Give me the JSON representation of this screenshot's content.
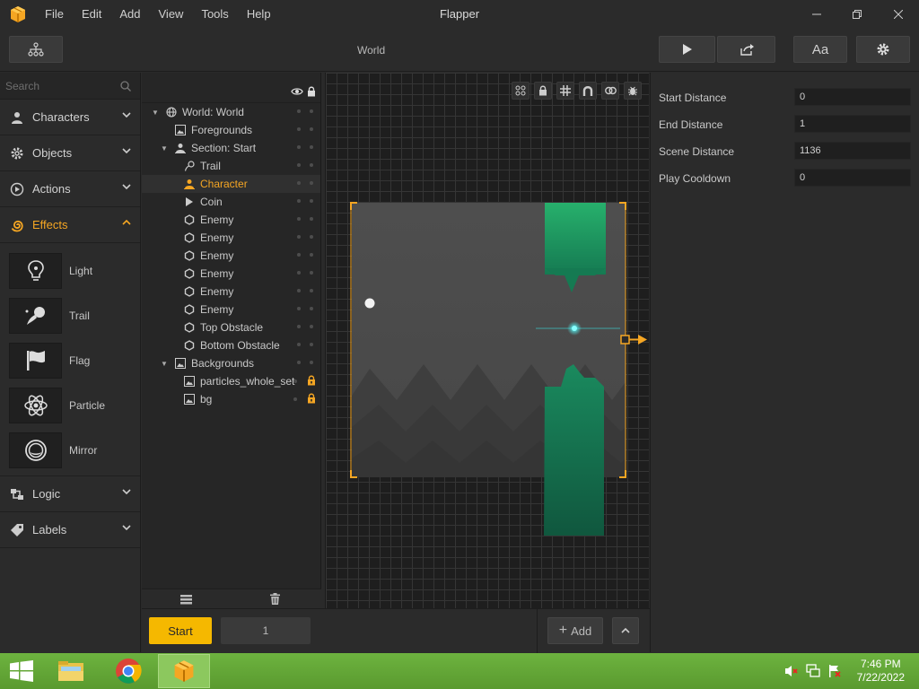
{
  "app": {
    "title": "Flapper"
  },
  "menu": [
    "File",
    "Edit",
    "Add",
    "View",
    "Tools",
    "Help"
  ],
  "toolbar": {
    "breadcrumb": "World",
    "font_button": "Aa"
  },
  "sidebar": {
    "search_placeholder": "Search",
    "categories_top": [
      {
        "label": "Characters",
        "icon": "person-icon"
      },
      {
        "label": "Objects",
        "icon": "gear-icon"
      },
      {
        "label": "Actions",
        "icon": "play-circle-icon"
      },
      {
        "label": "Effects",
        "icon": "spiral-icon"
      }
    ],
    "effects": [
      "Light",
      "Trail",
      "Flag",
      "Particle",
      "Mirror"
    ],
    "categories_bottom": [
      {
        "label": "Logic",
        "icon": "logic-icon"
      },
      {
        "label": "Labels",
        "icon": "tag-icon"
      }
    ]
  },
  "tree": {
    "items": [
      {
        "label": "World: World",
        "icon": "globe-icon"
      },
      {
        "label": "Foregrounds",
        "icon": "image-icon"
      },
      {
        "label": "Section: Start",
        "icon": "person-icon"
      },
      {
        "label": "Trail",
        "icon": "trail-icon"
      },
      {
        "label": "Character",
        "icon": "person-icon"
      },
      {
        "label": "Coin",
        "icon": "play-icon"
      },
      {
        "label": "Enemy",
        "icon": "hexagon-icon"
      },
      {
        "label": "Enemy",
        "icon": "hexagon-icon"
      },
      {
        "label": "Enemy",
        "icon": "hexagon-icon"
      },
      {
        "label": "Enemy",
        "icon": "hexagon-icon"
      },
      {
        "label": "Enemy",
        "icon": "hexagon-icon"
      },
      {
        "label": "Enemy",
        "icon": "hexagon-icon"
      },
      {
        "label": "Top Obstacle",
        "icon": "hexagon-icon"
      },
      {
        "label": "Bottom Obstacle",
        "icon": "hexagon-icon"
      },
      {
        "label": "Backgrounds",
        "icon": "image-icon"
      },
      {
        "label": "particles_whole_set",
        "icon": "image-icon"
      },
      {
        "label": "bg",
        "icon": "image-icon"
      }
    ]
  },
  "properties": [
    {
      "label": "Start Distance",
      "value": "0"
    },
    {
      "label": "End Distance",
      "value": "1"
    },
    {
      "label": "Scene Distance",
      "value": "1136"
    },
    {
      "label": "Play Cooldown",
      "value": "0"
    }
  ],
  "bottom": {
    "start_label": "Start",
    "section_number": "1",
    "add_label": "Add"
  },
  "taskbar": {
    "time": "7:46 PM",
    "date": "7/22/2022"
  },
  "colors": {
    "accent": "#f5a623",
    "obstacle": "#1f8f62",
    "taskbar": "#62a836"
  }
}
